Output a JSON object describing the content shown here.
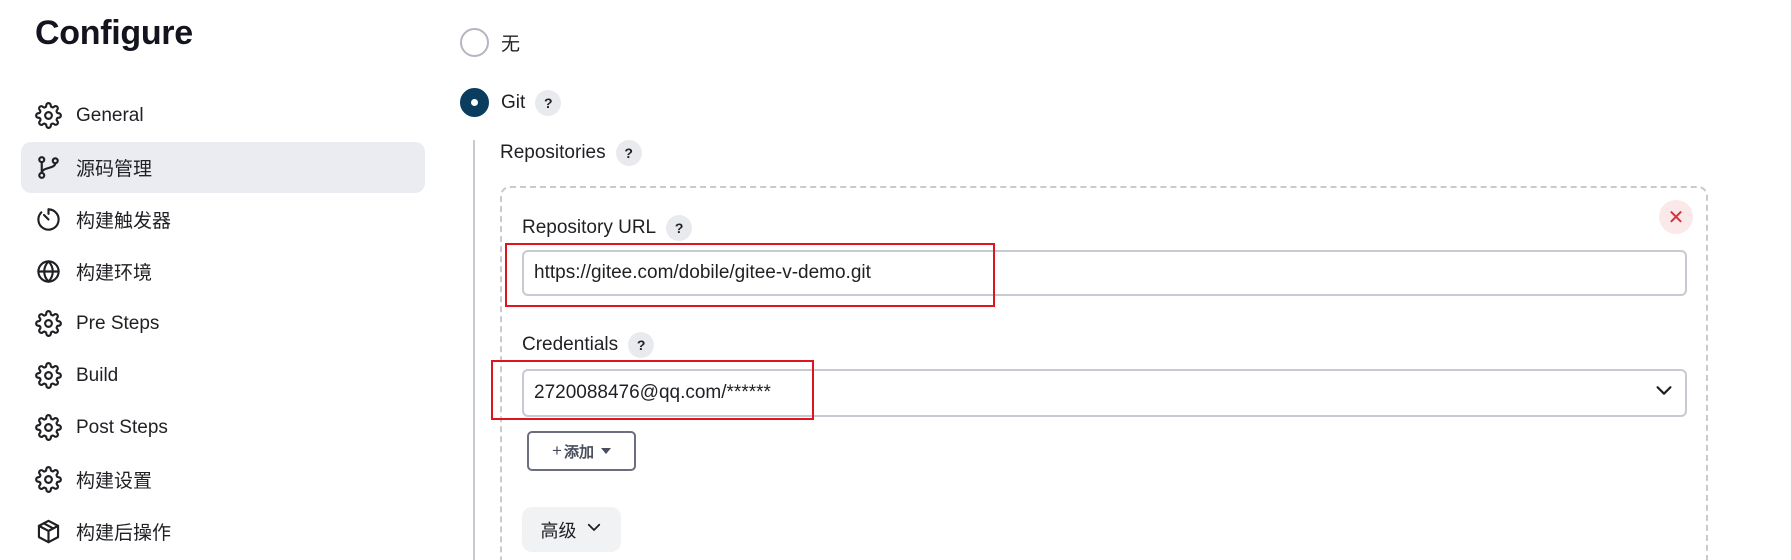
{
  "page": {
    "title": "Configure"
  },
  "sidebar": {
    "items": [
      {
        "label": "General",
        "icon": "gear-icon",
        "active": false
      },
      {
        "label": "源码管理",
        "icon": "git-branch-icon",
        "active": true
      },
      {
        "label": "构建触发器",
        "icon": "timer-icon",
        "active": false
      },
      {
        "label": "构建环境",
        "icon": "globe-icon",
        "active": false
      },
      {
        "label": "Pre Steps",
        "icon": "gear-icon",
        "active": false
      },
      {
        "label": "Build",
        "icon": "gear-icon",
        "active": false
      },
      {
        "label": "Post Steps",
        "icon": "gear-icon",
        "active": false
      },
      {
        "label": "构建设置",
        "icon": "gear-icon",
        "active": false
      },
      {
        "label": "构建后操作",
        "icon": "package-icon",
        "active": false
      }
    ]
  },
  "scm": {
    "options": [
      {
        "label": "无",
        "checked": false
      },
      {
        "label": "Git",
        "checked": true
      }
    ],
    "help_symbol": "?",
    "repositories_label": "Repositories",
    "repository_url_label": "Repository URL",
    "repository_url_value": "https://gitee.com/dobile/gitee-v-demo.git",
    "credentials_label": "Credentials",
    "credentials_value": "2720088476@qq.com/******",
    "add_button_plus": "+",
    "add_button_label": "添加",
    "advanced_label": "高级",
    "remove_symbol": "✕"
  },
  "colors": {
    "accent": "#0b3d5e",
    "active_bg": "#ebecf1",
    "highlight_red": "#e0141e",
    "remove_red": "#d6313c"
  }
}
